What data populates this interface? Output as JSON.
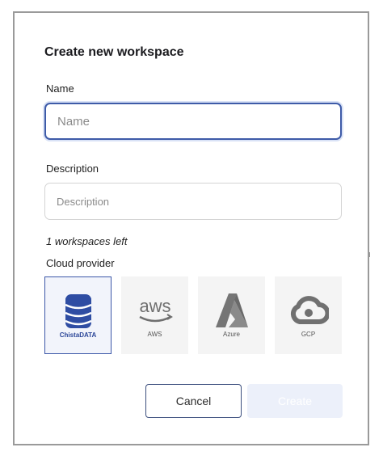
{
  "dialog": {
    "title": "Create new workspace",
    "name_label": "Name",
    "name_placeholder": "Name",
    "description_label": "Description",
    "description_placeholder": "Description",
    "workspaces_left": "1 workspaces left",
    "cloud_provider_label": "Cloud provider",
    "providers": [
      {
        "label": "ChistaDATA",
        "icon": "database-icon",
        "selected": true
      },
      {
        "label": "AWS",
        "icon": "aws-logo-icon",
        "selected": false
      },
      {
        "label": "Azure",
        "icon": "azure-logo-icon",
        "selected": false
      },
      {
        "label": "GCP",
        "icon": "gcp-cloud-icon",
        "selected": false
      }
    ],
    "cancel_label": "Cancel",
    "create_label": "Create"
  },
  "aws_logo_text": "aws",
  "colors": {
    "accent": "#2f4da3",
    "focus_border": "#3e5ba8",
    "selected_tile_bg": "#f2f4fb",
    "disabled_button_bg": "#ecf0fa",
    "tile_bg": "#f4f4f4"
  }
}
